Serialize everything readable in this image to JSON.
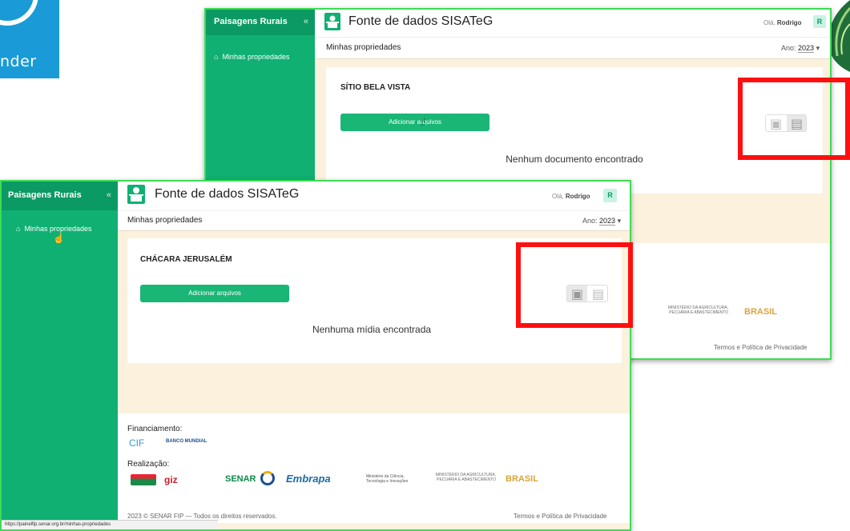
{
  "background_logo": {
    "text": "nder"
  },
  "back_window": {
    "brand": "Paisagens Rurais",
    "collapse": "«",
    "nav_item": "Minhas propriedades",
    "app_title": "Fonte de dados SISATeG",
    "greeting_prefix": "Olá,",
    "user_name": "Rodrigo",
    "avatar": "R",
    "breadcrumb": "Minhas propriedades",
    "year_label": "Ano:",
    "year_value": "2023",
    "property_name": "SÍTIO BELA VISTA",
    "add_button": "Adicionar arquivos",
    "empty_message": "Nenhum documento encontrado",
    "active_tab": "documents",
    "footer_logo_ministry": "MINISTÉRIO DA AGRICULTURA, PECUÁRIA E ABASTECIMENTO",
    "footer_logo_brasil": "BRASIL",
    "terms": "Termos e Política de Privacidade"
  },
  "front_window": {
    "brand": "Paisagens Rurais",
    "collapse": "«",
    "nav_item": "Minhas propriedades",
    "app_title": "Fonte de dados SISATeG",
    "greeting_prefix": "Olá,",
    "user_name": "Rodrigo",
    "avatar": "R",
    "breadcrumb": "Minhas propriedades",
    "year_label": "Ano:",
    "year_value": "2023",
    "property_name": "CHÁCARA JERUSALÉM",
    "add_button": "Adicionar arquivos",
    "empty_message": "Nenhuma mídia encontrada",
    "active_tab": "media",
    "footer": {
      "funding_label": "Financiamento:",
      "funding_logos": [
        "CIF",
        "BANCO MUNDIAL"
      ],
      "realization_label": "Realização:",
      "realization_logos": [
        "giz",
        "SENAR",
        "Embrapa",
        "Ministério da Ciência, Tecnologia e Inovações",
        "MINISTÉRIO DA AGRICULTURA, PECUÁRIA E ABASTECIMENTO",
        "BRASIL"
      ],
      "copyright": "2023 © SENAR FIP — Todos os direitos reservados.",
      "terms": "Termos e Política de Privacidade"
    },
    "status_url": "https://painelfip.senar.org.br/minhas-propriedades"
  },
  "colors": {
    "sidebar": "#0fb072",
    "accent": "#1ab676",
    "highlight": "#ff1010",
    "window_border": "#3ddc55",
    "content_bg": "#fbf1dd"
  }
}
